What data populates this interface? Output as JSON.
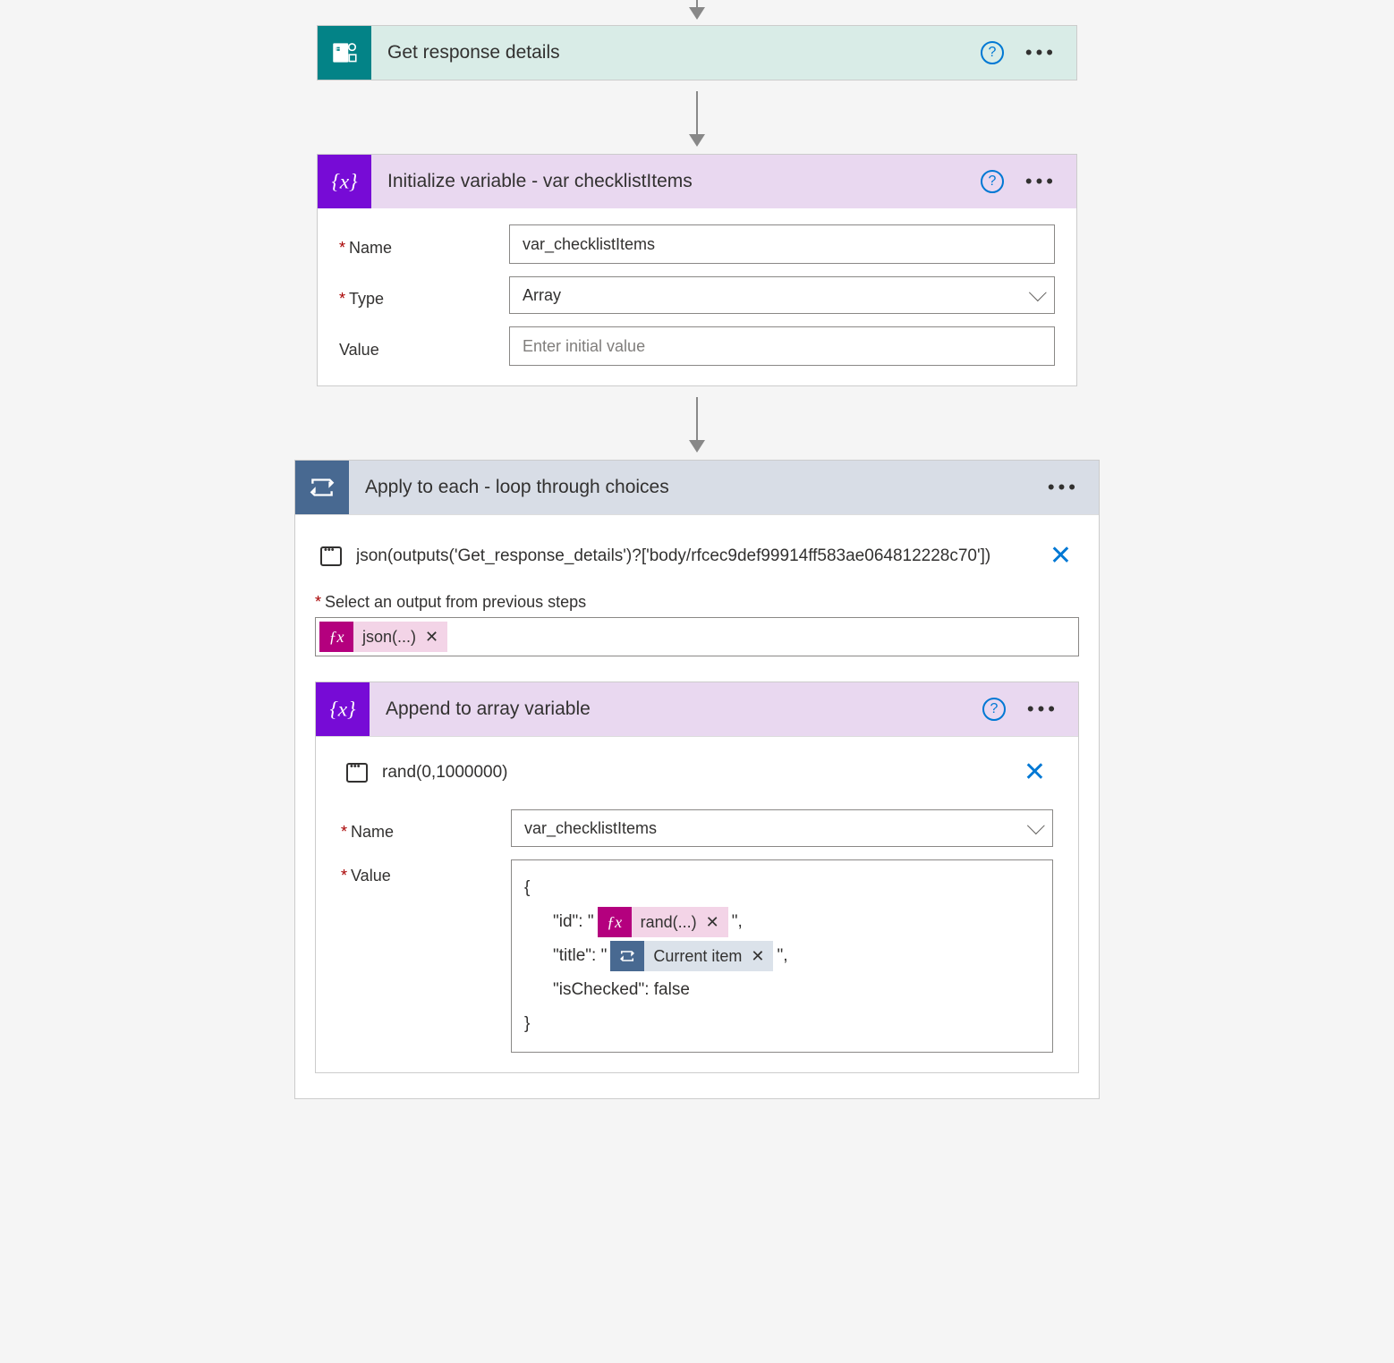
{
  "step1": {
    "title": "Get response details"
  },
  "step2": {
    "title": "Initialize variable - var checklistItems",
    "name_label": "Name",
    "name_value": "var_checklistItems",
    "type_label": "Type",
    "type_value": "Array",
    "value_label": "Value",
    "value_placeholder": "Enter initial value"
  },
  "step3": {
    "title": "Apply to each - loop through choices",
    "peek_expr": "json(outputs('Get_response_details')?['body/rfcec9def99914ff583ae064812228c70'])",
    "select_label": "Select an output from previous steps",
    "fx_token": "json(...)"
  },
  "step4": {
    "title": "Append to array variable",
    "peek_expr": "rand(0,1000000)",
    "name_label": "Name",
    "name_value": "var_checklistItems",
    "value_label": "Value",
    "json": {
      "open": "{",
      "id_key": "\"id\": \"",
      "id_token": "rand(...)",
      "id_tail": "\",",
      "title_key": "\"title\": \"",
      "title_token": "Current item",
      "title_tail": "\",",
      "checked_line": "\"isChecked\": false",
      "close": "}"
    }
  }
}
